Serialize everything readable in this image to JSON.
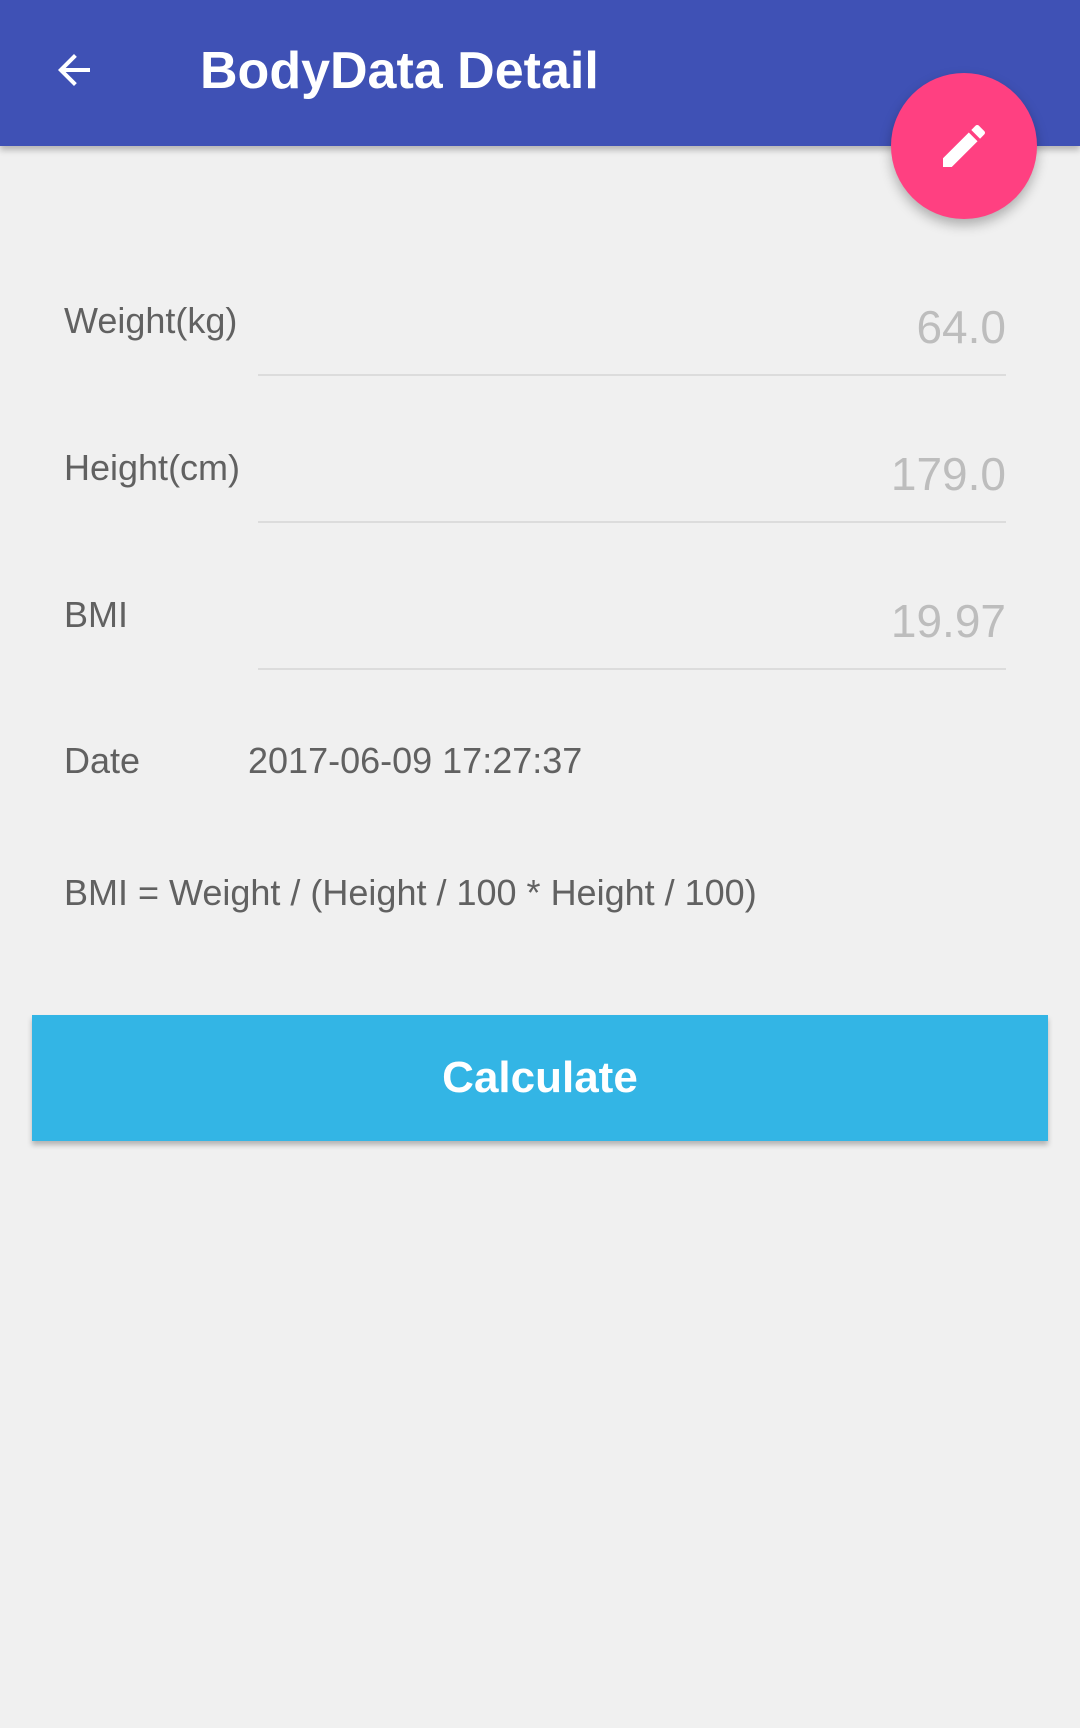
{
  "appbar": {
    "title": "BodyData Detail",
    "color": "#3f51b5"
  },
  "fab": {
    "icon": "pencil-icon",
    "color": "#ff4081"
  },
  "fields": {
    "weight": {
      "label": "Weight(kg)",
      "value": "64.0"
    },
    "height": {
      "label": "Height(cm)",
      "value": "179.0"
    },
    "bmi": {
      "label": "BMI",
      "value": "19.97"
    },
    "date": {
      "label": "Date",
      "value": "2017-06-09 17:27:37"
    }
  },
  "formula": "BMI = Weight / (Height / 100 * Height / 100)",
  "calculate_button": {
    "label": "Calculate",
    "color": "#33b5e5"
  }
}
